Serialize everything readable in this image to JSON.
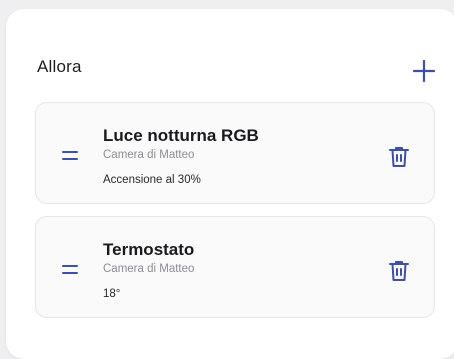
{
  "header": {
    "title": "Allora"
  },
  "colors": {
    "accent": "#3d4fa8",
    "background": "#efeff1",
    "card": "#fafafb"
  },
  "icons": {
    "add": "plus-icon",
    "drag": "drag-handle-icon",
    "delete": "trash-icon"
  },
  "devices": [
    {
      "name": "Luce notturna RGB",
      "room": "Camera di Matteo",
      "status": "Accensione al 30%"
    },
    {
      "name": "Termostato",
      "room": "Camera di Matteo",
      "status": "18°"
    }
  ]
}
